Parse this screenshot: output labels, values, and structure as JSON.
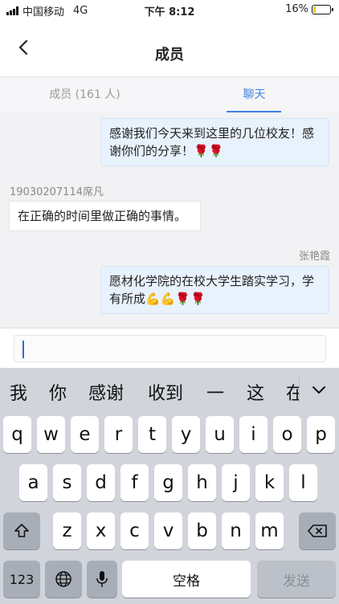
{
  "status": {
    "carrier": "中国移动",
    "network": "4G",
    "time": "下午 8:12",
    "battery": "16%",
    "battery_level": 0.16
  },
  "nav": {
    "title": "成员"
  },
  "tabs": [
    {
      "label": "成员 (161 人)"
    },
    {
      "label": "聊天"
    }
  ],
  "messages": [
    {
      "line1": "感谢我们今天来到这里的几位校友！感",
      "line2": "谢你们的分享！🌹🌹"
    },
    {
      "sender": "19030207114席凡",
      "line1": "在正确的时间里做正确的事情。"
    },
    {
      "sender": "张艳霞",
      "line1": "愿材化学院的在校大学生踏实学习，学",
      "line2": "有所成💪💪🌹🌹"
    }
  ],
  "keyboard": {
    "candidates": [
      "我",
      "你",
      "感谢",
      "收到",
      "一",
      "这",
      "在"
    ],
    "row1": [
      "q",
      "w",
      "e",
      "r",
      "t",
      "y",
      "u",
      "i",
      "o",
      "p"
    ],
    "row2": [
      "a",
      "s",
      "d",
      "f",
      "g",
      "h",
      "j",
      "k",
      "l"
    ],
    "row3": [
      "z",
      "x",
      "c",
      "v",
      "b",
      "n",
      "m"
    ],
    "num_label": "123",
    "space_label": "空格",
    "send_label": "发送"
  }
}
